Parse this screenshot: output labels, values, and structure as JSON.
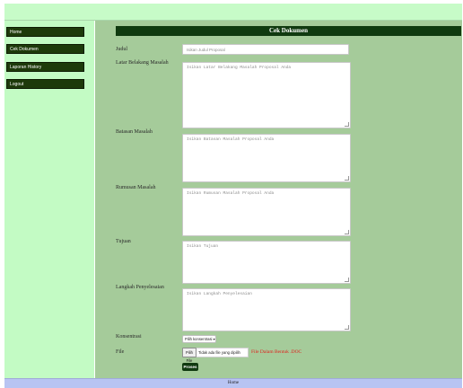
{
  "sidebar": {
    "items": [
      {
        "label": "Home"
      },
      {
        "label": "Cek Dokumen"
      },
      {
        "label": "Laporan History"
      },
      {
        "label": "Logout"
      }
    ]
  },
  "form": {
    "title": "Cek Dokumen",
    "fields": {
      "judul": {
        "label": "Judul",
        "placeholder": "Isikan Judul Proposal"
      },
      "latar": {
        "label": "Latar Belakang Masalah",
        "placeholder": "Isikan Latar Belakang Masalah Proposal Anda"
      },
      "batasan": {
        "label": "Batasan Masalah",
        "placeholder": "Isikan Batasan Masalah Proposal Anda"
      },
      "rumusan": {
        "label": "Rumusan Masalah",
        "placeholder": "Isikan Rumusan Masalah Proposal Anda"
      },
      "tujuan": {
        "label": "Tujuan",
        "placeholder": "Isikan Tujuan"
      },
      "langkah": {
        "label": "Langkah Penyelesaian",
        "placeholder": "Isikan Langkah Penyelesaian"
      },
      "konsentrasi": {
        "label": "Konsentrasi",
        "selected": "Pilih konsentrasi"
      },
      "file": {
        "label": "File",
        "button": "Pilih File",
        "value": "Tidak ada file yang dipilih",
        "note": "File Dalam Bentuk .DOC"
      }
    },
    "submit_label": "Proses"
  },
  "footer": {
    "text": "Home"
  },
  "colors": {
    "sidebar_button": "#1d3a0a",
    "main_bg": "#a5cb9a",
    "header_bar": "#103a10",
    "accent_red": "#e0201c",
    "footer_bg": "#b8c4f2"
  }
}
